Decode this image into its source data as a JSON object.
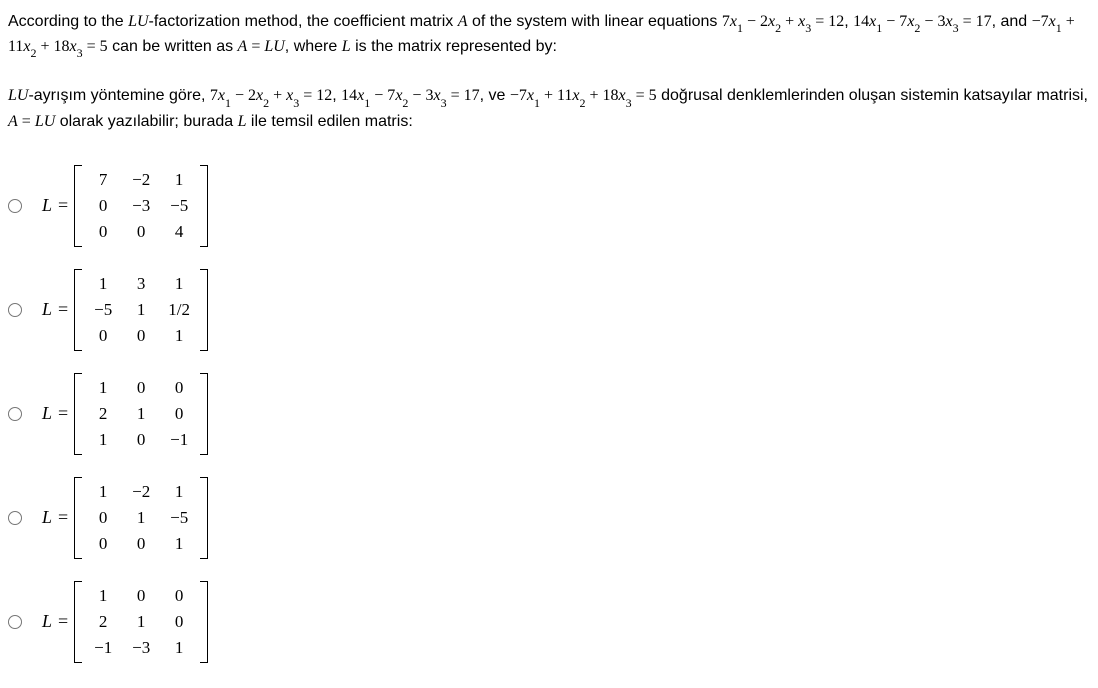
{
  "question": {
    "en_part1": "According to the ",
    "en_LU": "LU",
    "en_part2": "-factorization method, the coefficient matrix ",
    "en_A": "A",
    "en_part3": " of the system with linear equations ",
    "eq1_lhs": "7x₁ − 2x₂ + x₃",
    "eq1_rhs": "12",
    "en_comma1": ", ",
    "eq2_lhs": "14x₁ − 7x₂ − 3x₃",
    "eq2_rhs": "17",
    "en_and": ", and ",
    "eq3_lhs": "−7x₁ + 11x₂ + 18x₃",
    "eq3_rhs": "5",
    "en_part4": " can be written as ",
    "en_AeqLU": "A = LU",
    "en_part5": ", where ",
    "en_L": "L",
    "en_part6": " is the matrix represented by:",
    "tr_LU": "LU",
    "tr_part1": "-ayrışım yöntemine göre, ",
    "tr_comma1": ", ",
    "tr_ve": ", ve ",
    "tr_part2": " doğrusal denklemlerinden oluşan sistemin katsayılar matrisi, ",
    "tr_AeqLU": "A = LU",
    "tr_part3": " olarak yazılabilir; burada ",
    "tr_L": "L",
    "tr_part4": " ile temsil edilen matris:"
  },
  "chart_data": {
    "type": "table",
    "description": "Five 3x3 matrix options for L in LU factorization",
    "options": [
      {
        "label": "L",
        "matrix": [
          [
            "7",
            "−2",
            "1"
          ],
          [
            "0",
            "−3",
            "−5"
          ],
          [
            "0",
            "0",
            "4"
          ]
        ]
      },
      {
        "label": "L",
        "matrix": [
          [
            "1",
            "3",
            "1"
          ],
          [
            "−5",
            "1",
            "1/2"
          ],
          [
            "0",
            "0",
            "1"
          ]
        ]
      },
      {
        "label": "L",
        "matrix": [
          [
            "1",
            "0",
            "0"
          ],
          [
            "2",
            "1",
            "0"
          ],
          [
            "1",
            "0",
            "−1"
          ]
        ]
      },
      {
        "label": "L",
        "matrix": [
          [
            "1",
            "−2",
            "1"
          ],
          [
            "0",
            "1",
            "−5"
          ],
          [
            "0",
            "0",
            "1"
          ]
        ]
      },
      {
        "label": "L",
        "matrix": [
          [
            "1",
            "0",
            "0"
          ],
          [
            "2",
            "1",
            "0"
          ],
          [
            "−1",
            "−3",
            "1"
          ]
        ]
      }
    ]
  }
}
